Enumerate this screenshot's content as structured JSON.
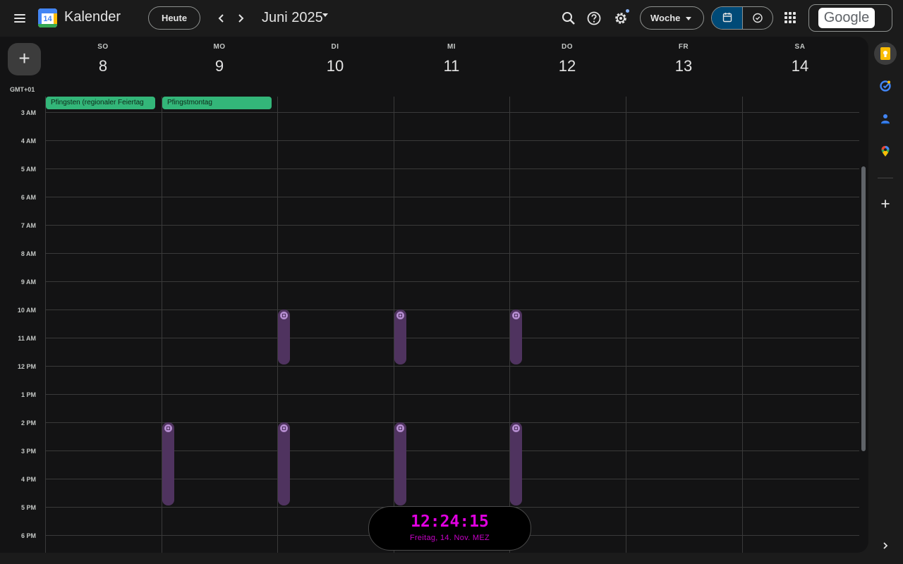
{
  "header": {
    "app_title": "Kalender",
    "logo_day": "14",
    "today_label": "Heute",
    "prev_label": "‹",
    "next_label": "›",
    "month_title": "Juni 2025",
    "view_label": "Woche",
    "account_label": "Google",
    "icons": [
      "menu-icon",
      "search-icon",
      "help-icon",
      "settings-icon",
      "calendar-view-icon",
      "tasks-view-icon",
      "apps-icon"
    ]
  },
  "fab_label": "+",
  "timezone": "GMT+01",
  "days": [
    {
      "dow": "SO",
      "num": "8"
    },
    {
      "dow": "MO",
      "num": "9"
    },
    {
      "dow": "DI",
      "num": "10"
    },
    {
      "dow": "MI",
      "num": "11"
    },
    {
      "dow": "DO",
      "num": "12"
    },
    {
      "dow": "FR",
      "num": "13"
    },
    {
      "dow": "SA",
      "num": "14"
    }
  ],
  "allday_events": [
    {
      "title": "Pfingsten (regionaler Feiertag"
    },
    {
      "title": "Pfingstmontag"
    }
  ],
  "hours": [
    "3 AM",
    "4 AM",
    "5 AM",
    "6 AM",
    "7 AM",
    "8 AM",
    "9 AM",
    "10 AM",
    "11 AM",
    "12 PM",
    "1 PM",
    "2 PM",
    "3 PM",
    "4 PM",
    "5 PM",
    "6 PM"
  ],
  "events": [
    {
      "day": 2,
      "start": 10.0,
      "end": 12.0
    },
    {
      "day": 3,
      "start": 10.0,
      "end": 12.0
    },
    {
      "day": 4,
      "start": 10.0,
      "end": 12.0
    },
    {
      "day": 1,
      "start": 14.0,
      "end": 17.0
    },
    {
      "day": 2,
      "start": 14.0,
      "end": 17.0
    },
    {
      "day": 3,
      "start": 14.0,
      "end": 17.0
    },
    {
      "day": 4,
      "start": 14.0,
      "end": 17.0
    }
  ],
  "clock": {
    "time": "12:24:15",
    "date": "Freitag, 14. Nov.  MEZ"
  },
  "side_panel": {
    "icons": [
      "keep-icon",
      "tasks-icon",
      "contacts-icon",
      "maps-icon",
      "add-icon",
      "expand-icon"
    ]
  },
  "colors": {
    "background": "#1b1b1b",
    "grid_background": "#131314",
    "holiday_green": "#33b679",
    "event_purple": "#4f335f",
    "active_view": "#004a77",
    "clock_magenta": "#e000e0"
  }
}
